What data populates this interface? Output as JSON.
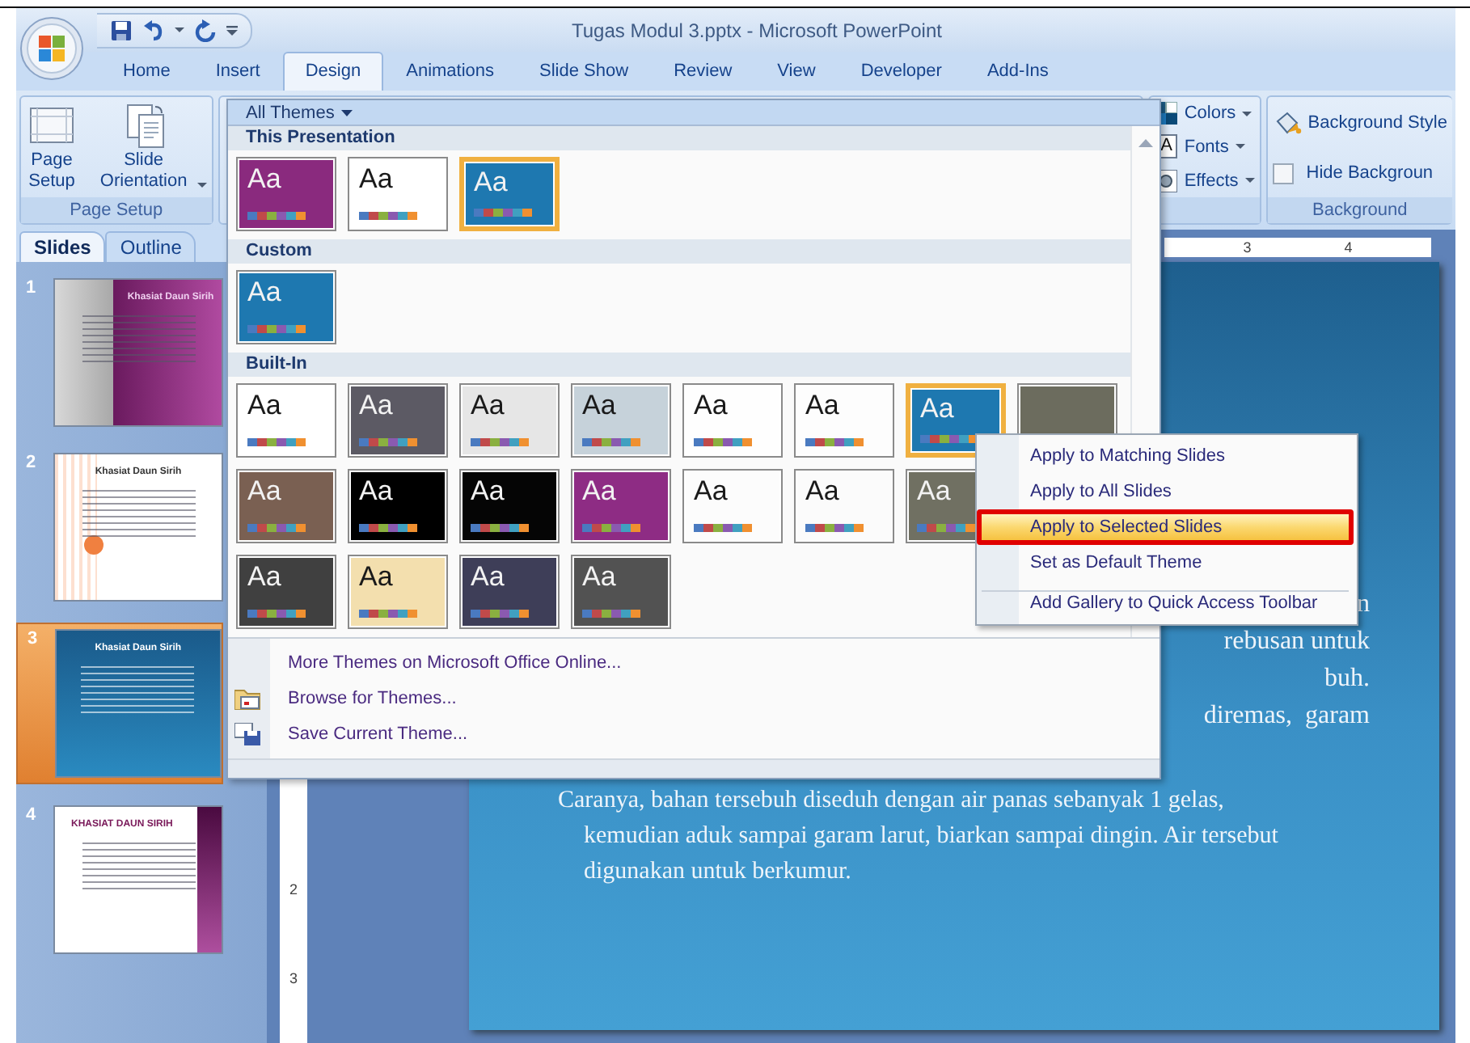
{
  "window": {
    "title": "Tugas Modul 3.pptx - Microsoft PowerPoint"
  },
  "ribbon_tabs": [
    {
      "label": "Home",
      "selected": false
    },
    {
      "label": "Insert",
      "selected": false
    },
    {
      "label": "Design",
      "selected": true
    },
    {
      "label": "Animations",
      "selected": false
    },
    {
      "label": "Slide Show",
      "selected": false
    },
    {
      "label": "Review",
      "selected": false
    },
    {
      "label": "View",
      "selected": false
    },
    {
      "label": "Developer",
      "selected": false
    },
    {
      "label": "Add-Ins",
      "selected": false
    }
  ],
  "ribbon": {
    "page_setup_group": {
      "buttons": [
        {
          "label": "Page Setup",
          "kind": "page"
        },
        {
          "label": "Slide Orientation",
          "kind": "orientation"
        }
      ],
      "label": "Page Setup"
    },
    "theme_options": [
      {
        "label": "Colors",
        "kind": "colors"
      },
      {
        "label": "Fonts",
        "kind": "fonts",
        "glyph": "A"
      },
      {
        "label": "Effects",
        "kind": "effects"
      }
    ],
    "background_group": {
      "styles_button": "Background Style",
      "hide_background": {
        "label": "Hide Backgroun",
        "checked": false
      },
      "label": "Background"
    }
  },
  "slide_pane": {
    "tabs": [
      {
        "label": "Slides",
        "selected": true
      },
      {
        "label": "Outline",
        "selected": false
      }
    ],
    "slides": [
      {
        "number": "1",
        "title": "Khasiat Daun Sirih",
        "kind": "gradient",
        "selected": false
      },
      {
        "number": "2",
        "title": "Khasiat Daun Sirih",
        "kind": "stripes",
        "selected": false
      },
      {
        "number": "3",
        "title": "Khasiat Daun Sirih",
        "kind": "wave",
        "selected": true
      },
      {
        "number": "4",
        "title": "KHASIAT DAUN SIRIH",
        "kind": "sidebar",
        "selected": false
      }
    ]
  },
  "rulers": {
    "horizontal": [
      "3",
      "4"
    ],
    "vertical": [
      "2",
      "3"
    ]
  },
  "slide": {
    "fragments": [
      "n",
      "rebusan untuk",
      "buh.",
      "diremas,  garam"
    ],
    "paragraph": "Caranya, bahan tersebuh diseduh dengan air panas sebanyak 1 gelas, kemudian aduk sampai garam larut, biarkan sampai dingin. Air tersebut digunakan untuk berkumur."
  },
  "theme_gallery": {
    "filter": "All Themes",
    "sections": [
      {
        "title": "This Presentation",
        "rows": [
          [
            {
              "label": "Aa",
              "color": "#8a2a7e",
              "selected": false
            },
            {
              "label": "Aa",
              "color": "#ffffff",
              "selected": false
            },
            {
              "label": "Aa",
              "color": "#1e78b0",
              "selected": true
            }
          ]
        ]
      },
      {
        "title": "Custom",
        "rows": [
          [
            {
              "label": "Aa",
              "color": "#1e78b0",
              "selected": false
            }
          ]
        ]
      },
      {
        "title": "Built-In",
        "rows": [
          [
            {
              "label": "Aa",
              "color": "#ffffff",
              "selected": false
            },
            {
              "label": "Aa",
              "color": "#5c5a64",
              "selected": false
            },
            {
              "label": "Aa",
              "color": "#e6e6e6",
              "selected": false
            },
            {
              "label": "Aa",
              "color": "#c6d2da",
              "selected": false
            },
            {
              "label": "Aa",
              "color": "#fefefe",
              "selected": false
            },
            {
              "label": "Aa",
              "color": "#fdfdfd",
              "selected": false
            },
            {
              "label": "Aa",
              "color": "#1e78b0",
              "selected": true
            },
            {
              "color": "#6c6c5e",
              "selected": false
            }
          ],
          [
            {
              "label": "Aa",
              "color": "#7a6052",
              "selected": false
            },
            {
              "label": "Aa",
              "color": "#000000",
              "selected": false
            },
            {
              "label": "Aa",
              "color": "#050505",
              "selected": false
            },
            {
              "label": "Aa",
              "color": "#8e2c84",
              "selected": false
            },
            {
              "label": "Aa",
              "color": "#fcfcfc",
              "selected": false
            },
            {
              "label": "Aa",
              "color": "#fbfbfb",
              "selected": false
            },
            {
              "label": "Aa",
              "color": "#707062",
              "selected": false
            }
          ],
          [
            {
              "label": "Aa",
              "color": "#404040",
              "selected": false
            },
            {
              "label": "Aa",
              "color": "#f3dfae",
              "selected": false
            },
            {
              "label": "Aa",
              "color": "#3e3e58",
              "selected": false
            },
            {
              "label": "Aa",
              "color": "#525252",
              "selected": false
            }
          ]
        ]
      }
    ],
    "commands": [
      {
        "label": "More Themes on Microsoft Office Online...",
        "kind": "plain"
      },
      {
        "label": "Browse for Themes...",
        "kind": "browse"
      },
      {
        "label": "Save Current Theme...",
        "kind": "save"
      }
    ]
  },
  "context_menu": {
    "items": [
      {
        "label": "Apply to Matching Slides",
        "selected": false,
        "outlined": false,
        "separator_above": false
      },
      {
        "label": "Apply to All Slides",
        "selected": false,
        "outlined": false,
        "separator_above": false
      },
      {
        "label": "Apply to Selected Slides",
        "selected": true,
        "outlined": true,
        "separator_above": false
      },
      {
        "label": "Set as Default Theme",
        "selected": false,
        "outlined": false,
        "separator_above": false
      },
      {
        "label": "Add Gallery to Quick Access Toolbar",
        "selected": false,
        "outlined": false,
        "separator_above": true
      }
    ]
  }
}
